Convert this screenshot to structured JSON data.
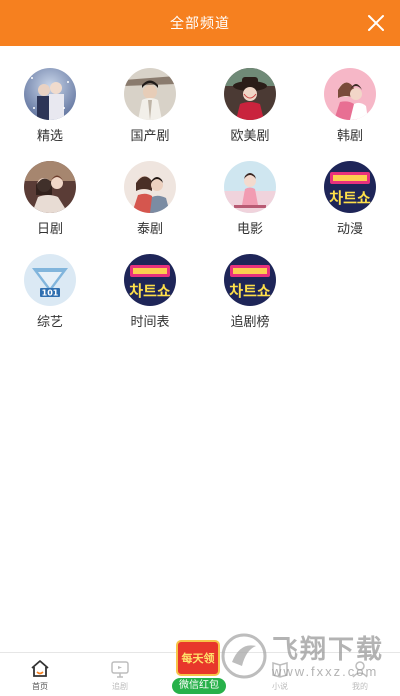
{
  "header": {
    "title": "全部频道"
  },
  "channels": [
    {
      "label": "精选",
      "thumb": "winter-couple"
    },
    {
      "label": "国产剧",
      "thumb": "costume-drama"
    },
    {
      "label": "欧美剧",
      "thumb": "woman-hat"
    },
    {
      "label": "韩剧",
      "thumb": "pink-couple"
    },
    {
      "label": "日剧",
      "thumb": "couple-embrace"
    },
    {
      "label": "泰剧",
      "thumb": "couple-sweater"
    },
    {
      "label": "电影",
      "thumb": "movie-poster"
    },
    {
      "label": "动漫",
      "thumb": "chart-show"
    },
    {
      "label": "综艺",
      "thumb": "produce-101"
    },
    {
      "label": "时间表",
      "thumb": "chart-show"
    },
    {
      "label": "追剧榜",
      "thumb": "chart-show"
    }
  ],
  "tabbar": {
    "tabs": [
      {
        "label": "首页",
        "icon": "home-icon",
        "active": true
      },
      {
        "label": "追剧",
        "icon": "tv-icon",
        "active": false
      },
      {
        "label": "",
        "icon": "",
        "active": false
      },
      {
        "label": "小说",
        "icon": "book-icon",
        "active": false
      },
      {
        "label": "我的",
        "icon": "user-icon",
        "active": false
      }
    ]
  },
  "redpack": {
    "badge": "每天领",
    "label": "微信红包"
  },
  "watermark": {
    "cn": "飞翔下载",
    "en": "www.fxxz.com"
  },
  "colors": {
    "brand": "#f6801f",
    "tab_active": "#333333",
    "tab_inactive": "#bdbdbd"
  }
}
